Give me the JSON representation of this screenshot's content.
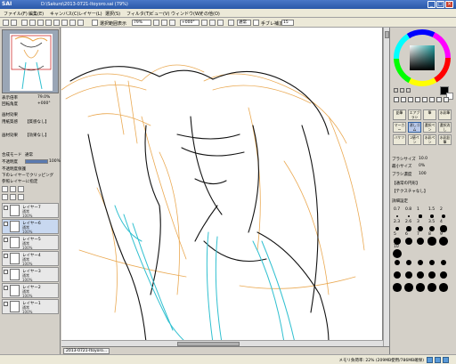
{
  "app": {
    "logo": "SAI",
    "title": "D:\\Sakuro\\2013-0721-Itoyoro.sai (79%)"
  },
  "menu": [
    "ファイル(F)",
    "編集(E)",
    "キャンバス(C)",
    "レイヤー(L)",
    "選択(S)",
    "フィルタ(T)",
    "ビュー(V)",
    "ウィンドウ(W)",
    "その他(O)"
  ],
  "toolbar": {
    "select_label": "選択範囲表示",
    "zoom": "79%",
    "angle": "+000°",
    "mode": "通常",
    "stabilizer_label": "手ブレ補正",
    "stabilizer_value": "15"
  },
  "left": {
    "zoom_label": "表示倍率",
    "zoom_value": "79.0%",
    "angle_label": "回転角度",
    "angle_value": "+000°",
    "effect_header": "画材効果",
    "paper_label": "用紙質感",
    "paper_value": "【質感なし】",
    "texture_label": "画材効果",
    "texture_value": "【効果なし】",
    "mode_label": "合成モード",
    "mode_value": "通常",
    "opacity_label": "不透明度",
    "opacity_value": "100%",
    "opacity_fill": 1.0,
    "checks": [
      "不透明度保護",
      "下のレイヤーでクリッピング",
      "参照レイヤーに指定"
    ],
    "layers": [
      {
        "name": "レイヤー7",
        "mode": "通常",
        "pct": "100%",
        "selected": false
      },
      {
        "name": "レイヤー6",
        "mode": "通常",
        "pct": "100%",
        "selected": true
      },
      {
        "name": "レイヤー5",
        "mode": "通常",
        "pct": "100%",
        "selected": false
      },
      {
        "name": "レイヤー4",
        "mode": "通常",
        "pct": "100%",
        "selected": false
      },
      {
        "name": "レイヤー3",
        "mode": "通常",
        "pct": "100%",
        "selected": false
      },
      {
        "name": "レイヤー2",
        "mode": "通常",
        "pct": "100%",
        "selected": false
      },
      {
        "name": "レイヤー1",
        "mode": "通常",
        "pct": "100%",
        "selected": false
      }
    ]
  },
  "right": {
    "tools": [
      "鉛筆",
      "エアブラシ",
      "筆",
      "水彩筆",
      "マーカー",
      "消しゴム",
      "選択ペン",
      "選択消し",
      "バケツ",
      "2値ペン",
      "水彩ペン",
      "水彩鉛筆"
    ],
    "brush_size_label": "ブラシサイズ",
    "brush_size_value": "10.0",
    "min_size_label": "最小サイズ",
    "min_size_value": "0%",
    "density_label": "ブラシ濃度",
    "density_value": "100",
    "shape_label": "【通常の円形】",
    "texture_label": "【テクスチャなし】",
    "detail_label": "詳細設定",
    "size_values": [
      "0.7",
      "0.8",
      "1",
      "1.5",
      "2",
      "2.3",
      "2.6",
      "3",
      "3.5",
      "4",
      "5",
      "6",
      "7",
      "8",
      "9",
      "10"
    ]
  },
  "doc": {
    "tab": "2013-0721-Itoyoro..."
  },
  "status": {
    "memory": "メモリ負荷率: 22% (209MB使用/786MB確保)"
  },
  "colors": {
    "accent": "#3060a0",
    "sketch_orange": "#e8a040",
    "sketch_cyan": "#30c0d0",
    "line_black": "#111111"
  }
}
